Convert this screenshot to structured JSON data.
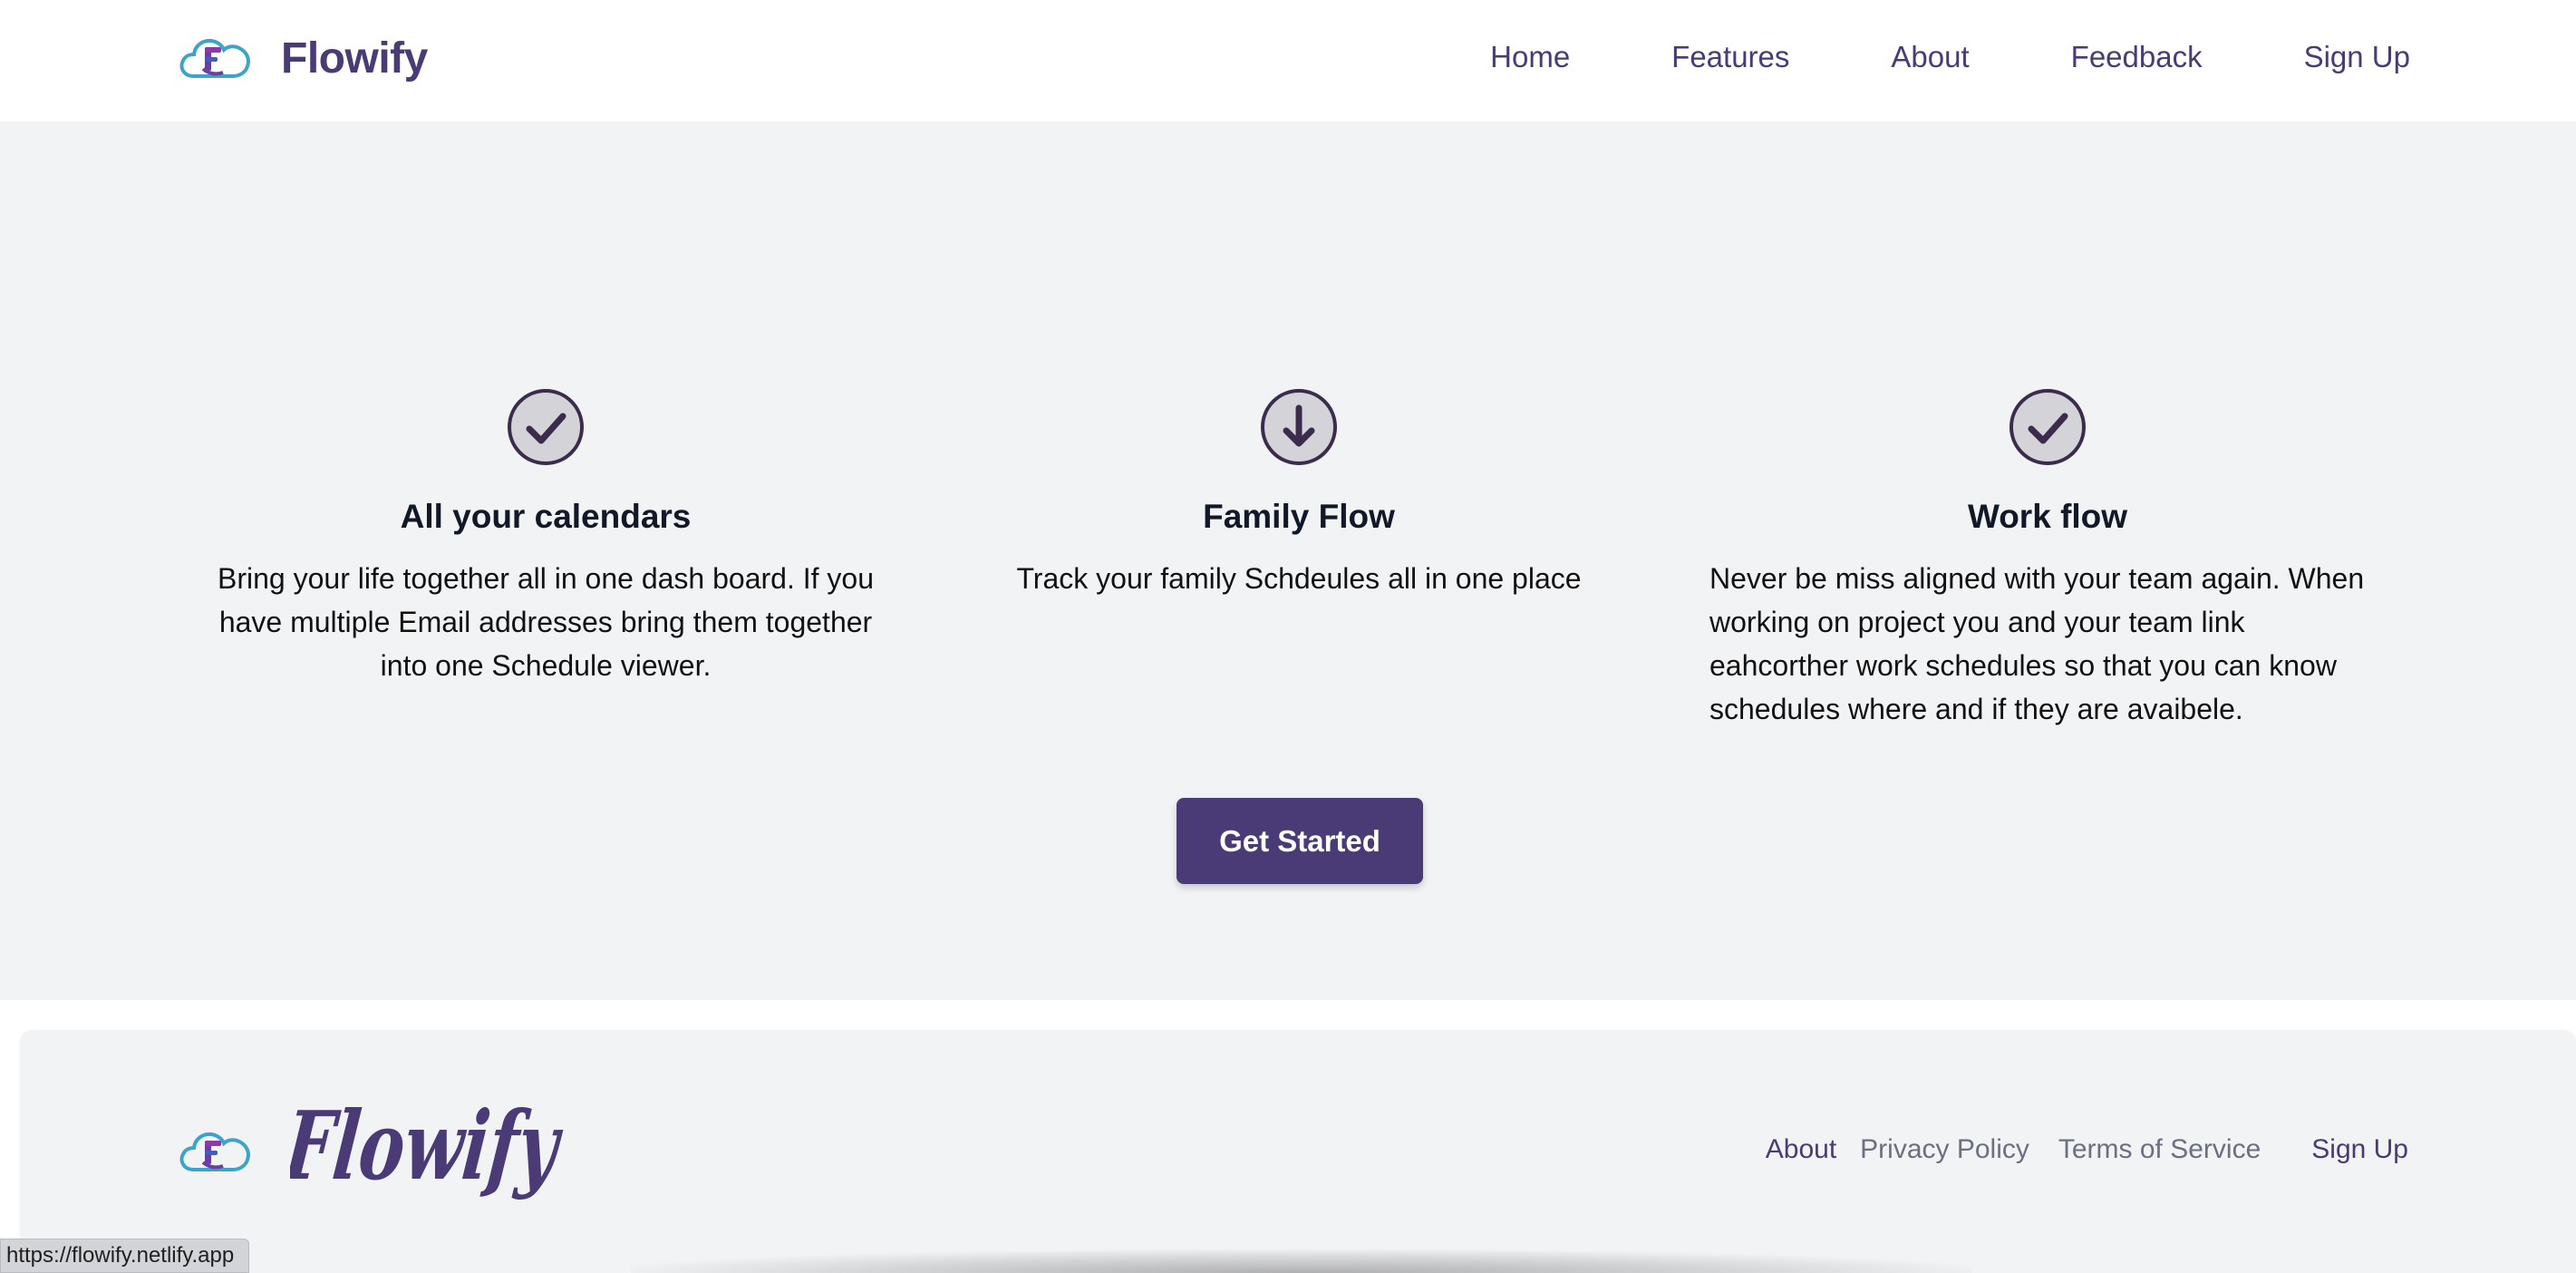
{
  "header": {
    "brand_name": "Flowify",
    "logo_icon": "cloud-f-logo-icon",
    "nav": [
      {
        "label": "Home"
      },
      {
        "label": "Features"
      },
      {
        "label": "About"
      },
      {
        "label": "Feedback"
      },
      {
        "label": "Sign Up"
      }
    ]
  },
  "features": [
    {
      "icon": "check-circle-icon",
      "title": "All your calendars",
      "text": "Bring your life together all in one dash board. If you have multiple Email addresses bring them together into one Schedule viewer."
    },
    {
      "icon": "arrow-down-circle-icon",
      "title": "Family Flow",
      "text": "Track your family Schdeules all in one place"
    },
    {
      "icon": "check-circle-icon",
      "title": "Work flow",
      "text": "Never be miss aligned with your team again. When working on project you and your team link eahcorther work schedules so that you can know schedules where and if they are avaibele."
    }
  ],
  "cta": {
    "label": "Get Started"
  },
  "footer": {
    "brand_script": "Flowify",
    "links": {
      "about": "About",
      "privacy": "Privacy Policy",
      "terms": "Terms of Service",
      "signup": "Sign Up"
    }
  },
  "status_bar": {
    "url": "https://flowify.netlify.app"
  },
  "colors": {
    "brand": "#4a3a75",
    "section_bg": "#f2f3f5",
    "muted_link": "#6b6f80",
    "icon_fill": "#d4d4d8"
  }
}
